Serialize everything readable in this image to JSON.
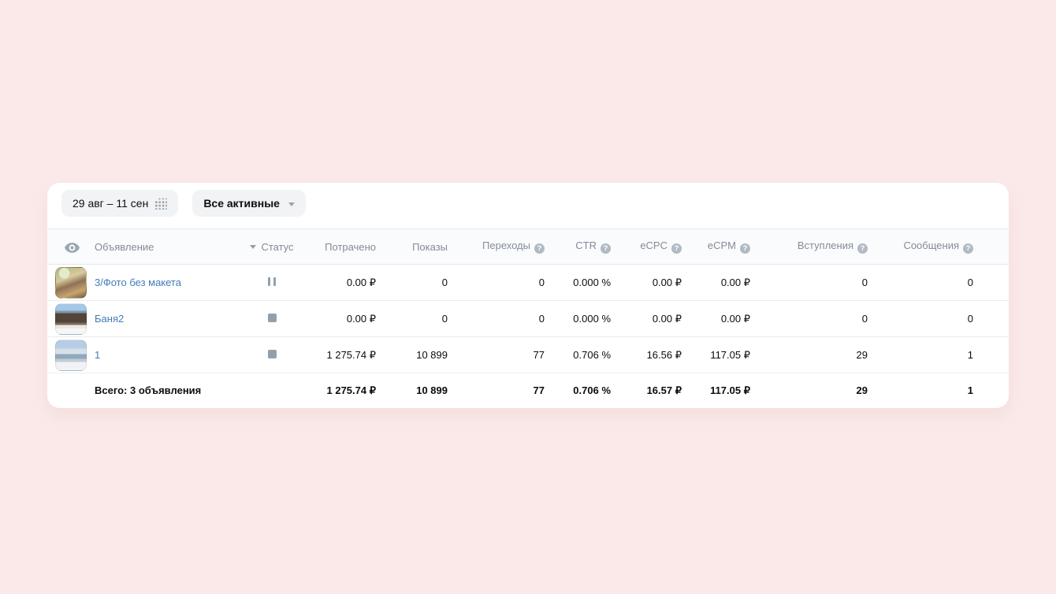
{
  "toolbar": {
    "date_range_label": "29 авг – 11 сен",
    "filter_label": "Все активные"
  },
  "icons": {
    "help_glyph": "?"
  },
  "table": {
    "headers": {
      "name": "Объявление",
      "status": "Статус",
      "spent": "Потрачено",
      "shows": "Показы",
      "clicks": "Переходы",
      "ctr": "CTR",
      "ecpc": "eCPC",
      "ecpm": "eCPM",
      "joins": "Вступления",
      "messages": "Сообщения"
    },
    "rows": [
      {
        "name": "3/Фото без макета",
        "status": "paused",
        "spent": "0.00 ₽",
        "shows": "0",
        "clicks": "0",
        "ctr": "0.000 %",
        "ecpc": "0.00 ₽",
        "ecpm": "0.00 ₽",
        "joins": "0",
        "messages": "0"
      },
      {
        "name": "Баня2",
        "status": "stopped",
        "spent": "0.00 ₽",
        "shows": "0",
        "clicks": "0",
        "ctr": "0.000 %",
        "ecpc": "0.00 ₽",
        "ecpm": "0.00 ₽",
        "joins": "0",
        "messages": "0"
      },
      {
        "name": "1",
        "status": "stopped",
        "spent": "1 275.74 ₽",
        "shows": "10 899",
        "clicks": "77",
        "ctr": "0.706 %",
        "ecpc": "16.56 ₽",
        "ecpm": "117.05 ₽",
        "joins": "29",
        "messages": "1"
      }
    ],
    "footer": {
      "label": "Всего: 3 объявления",
      "spent": "1 275.74 ₽",
      "shows": "10 899",
      "clicks": "77",
      "ctr": "0.706 %",
      "ecpc": "16.57 ₽",
      "ecpm": "117.05 ₽",
      "joins": "29",
      "messages": "1"
    }
  },
  "colors": {
    "page_background": "#fbe9e9",
    "card_background": "#ffffff",
    "link": "#447bba",
    "header_text": "#818c99",
    "muted_icon": "#99a2ad"
  }
}
